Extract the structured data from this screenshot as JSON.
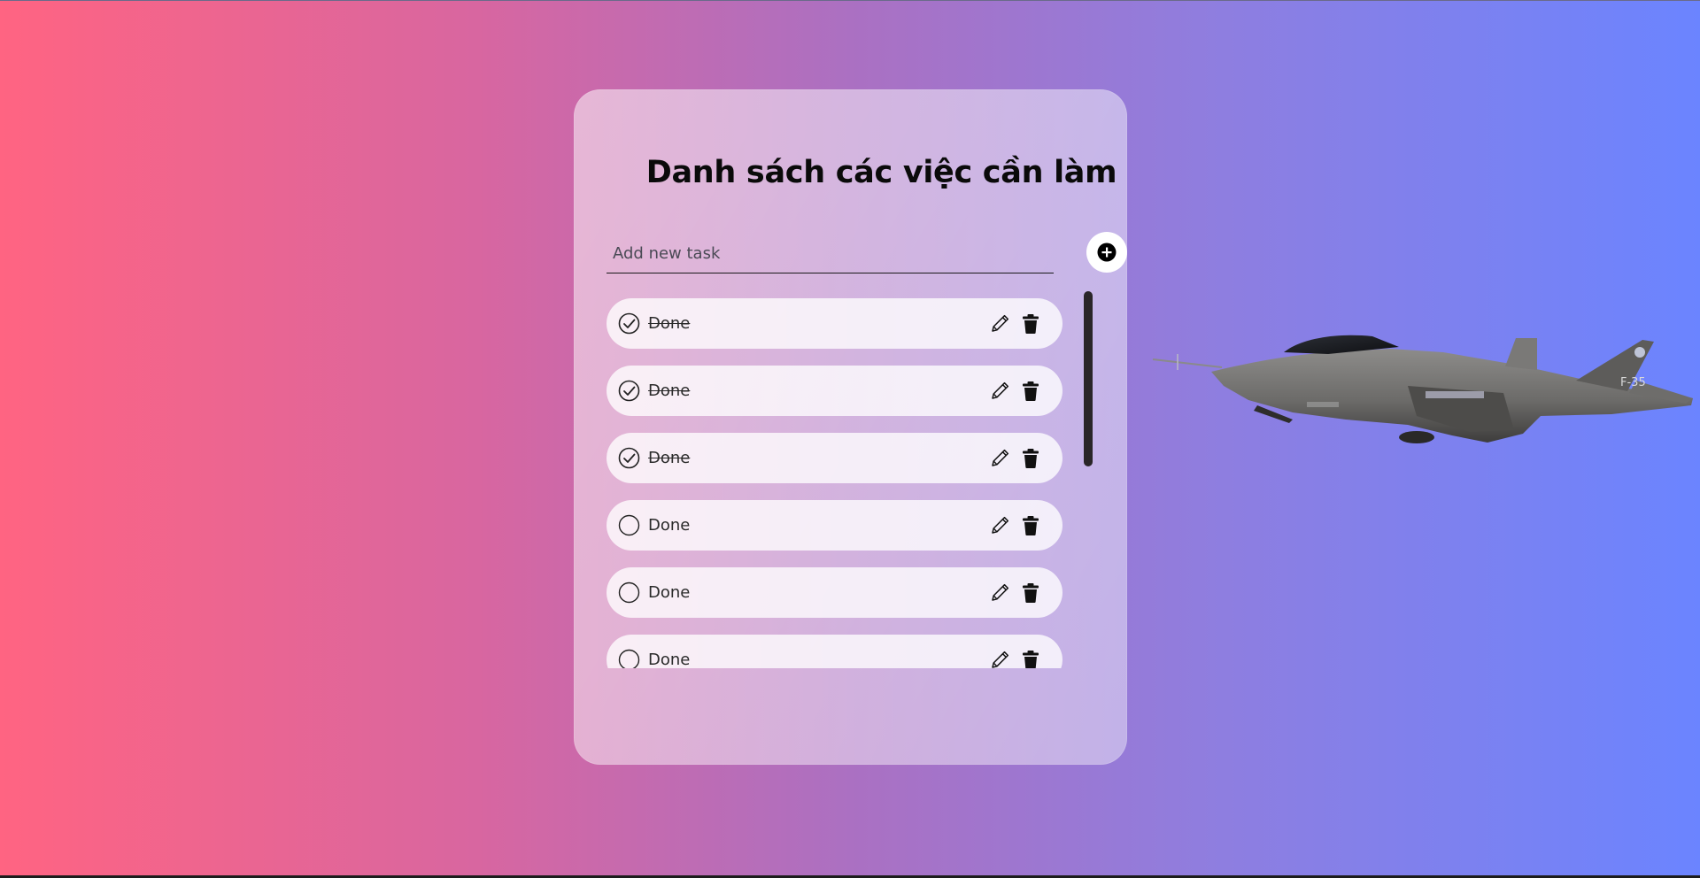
{
  "header": {
    "title": "Danh sách các việc cần làm"
  },
  "new_task": {
    "placeholder": "Add new task",
    "value": "",
    "add_icon": "plus-circle-icon"
  },
  "tasks": [
    {
      "label": "Done",
      "completed": true
    },
    {
      "label": "Done",
      "completed": true
    },
    {
      "label": "Done",
      "completed": true
    },
    {
      "label": "Done",
      "completed": false
    },
    {
      "label": "Done",
      "completed": false
    },
    {
      "label": "Done",
      "completed": false
    }
  ],
  "task_actions": {
    "edit_icon": "pencil-icon",
    "delete_icon": "trash-icon",
    "check_icon": "check-circle-icon",
    "empty_icon": "empty-circle-icon"
  },
  "colors": {
    "gradient_left": "#ff6482",
    "gradient_right": "#6b84ff",
    "card_bg": "rgba(255,255,255,0.5)",
    "text": "#0a0a0a"
  },
  "decor": {
    "aircraft_icon": "fighter-jet-image",
    "aircraft_marking": "F-35"
  }
}
